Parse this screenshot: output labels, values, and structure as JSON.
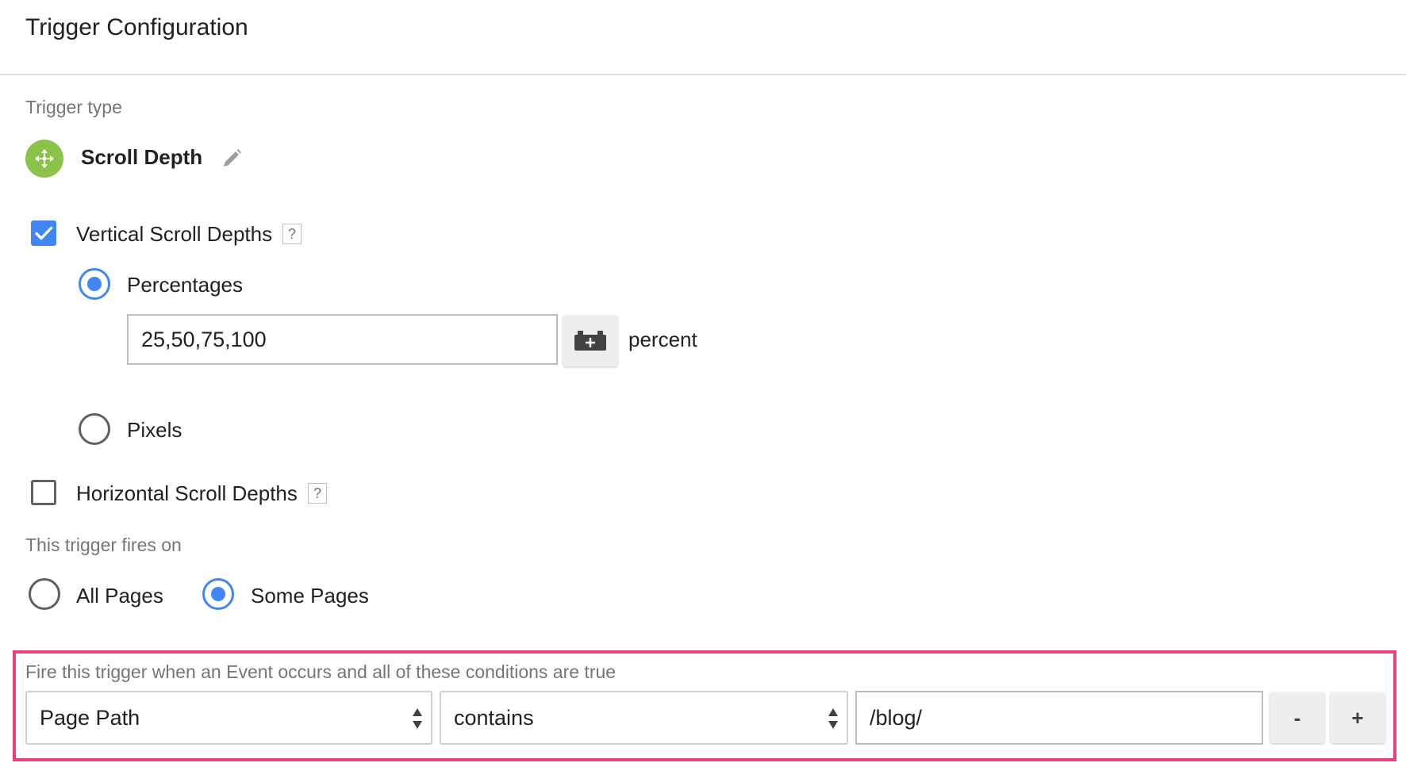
{
  "header": {
    "title": "Trigger Configuration"
  },
  "trigger_type": {
    "label": "Trigger type",
    "name": "Scroll Depth",
    "icon": "scroll-arrows-icon",
    "icon_color": "#8bc34a"
  },
  "vertical": {
    "label": "Vertical Scroll Depths",
    "checked": true,
    "help": "?",
    "options": {
      "percentages_label": "Percentages",
      "percentages_selected": true,
      "percentages_value": "25,50,75,100",
      "unit": "percent",
      "pixels_label": "Pixels",
      "pixels_selected": false
    }
  },
  "horizontal": {
    "label": "Horizontal Scroll Depths",
    "checked": false,
    "help": "?"
  },
  "fires_on": {
    "label": "This trigger fires on",
    "all_pages": "All Pages",
    "some_pages": "Some Pages",
    "selected": "Some Pages"
  },
  "condition": {
    "label": "Fire this trigger when an Event occurs and all of these conditions are true",
    "variable": "Page Path",
    "operator": "contains",
    "value": "/blog/",
    "remove_label": "-",
    "add_label": "+"
  },
  "colors": {
    "accent": "#4285f4",
    "highlight": "#ec407a"
  }
}
